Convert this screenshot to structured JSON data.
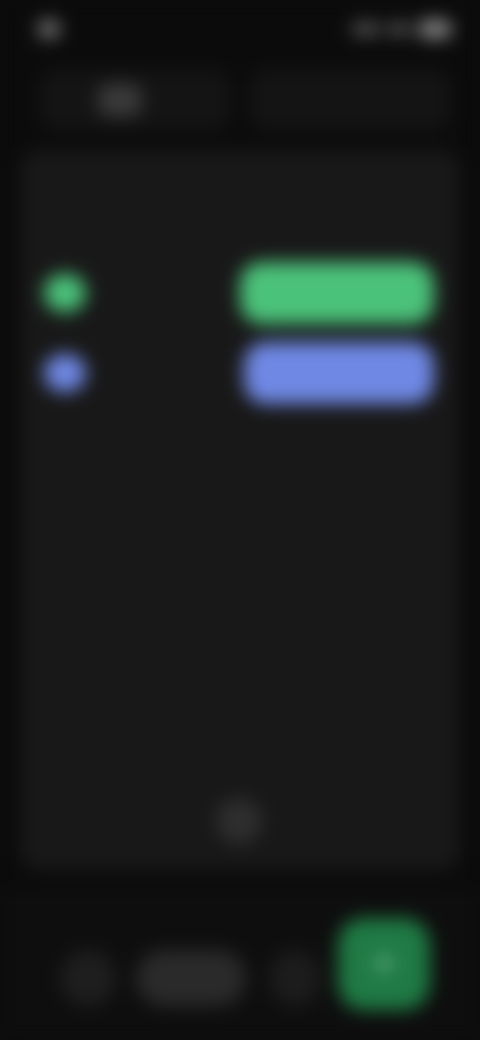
{
  "status_bar": {
    "time": "",
    "icons": [
      "signal-icon",
      "wifi-icon",
      "battery-icon"
    ]
  },
  "top_bar": {
    "tabs": [
      {
        "label": "",
        "icon": "list-icon"
      },
      {
        "label": ""
      }
    ]
  },
  "main": {
    "section_title": "",
    "legend": [
      {
        "label": "",
        "color": "#4bc27a"
      },
      {
        "label": "",
        "color": "#6f88e4"
      }
    ]
  },
  "bottom_nav": {
    "items": [
      {
        "label": "",
        "icon": "back-icon"
      },
      {
        "label": "",
        "icon": "home-icon"
      },
      {
        "label": "",
        "icon": "recent-icon"
      }
    ],
    "action": {
      "icon": "plus-icon",
      "symbol": "+",
      "color": "#1f7a44"
    }
  }
}
